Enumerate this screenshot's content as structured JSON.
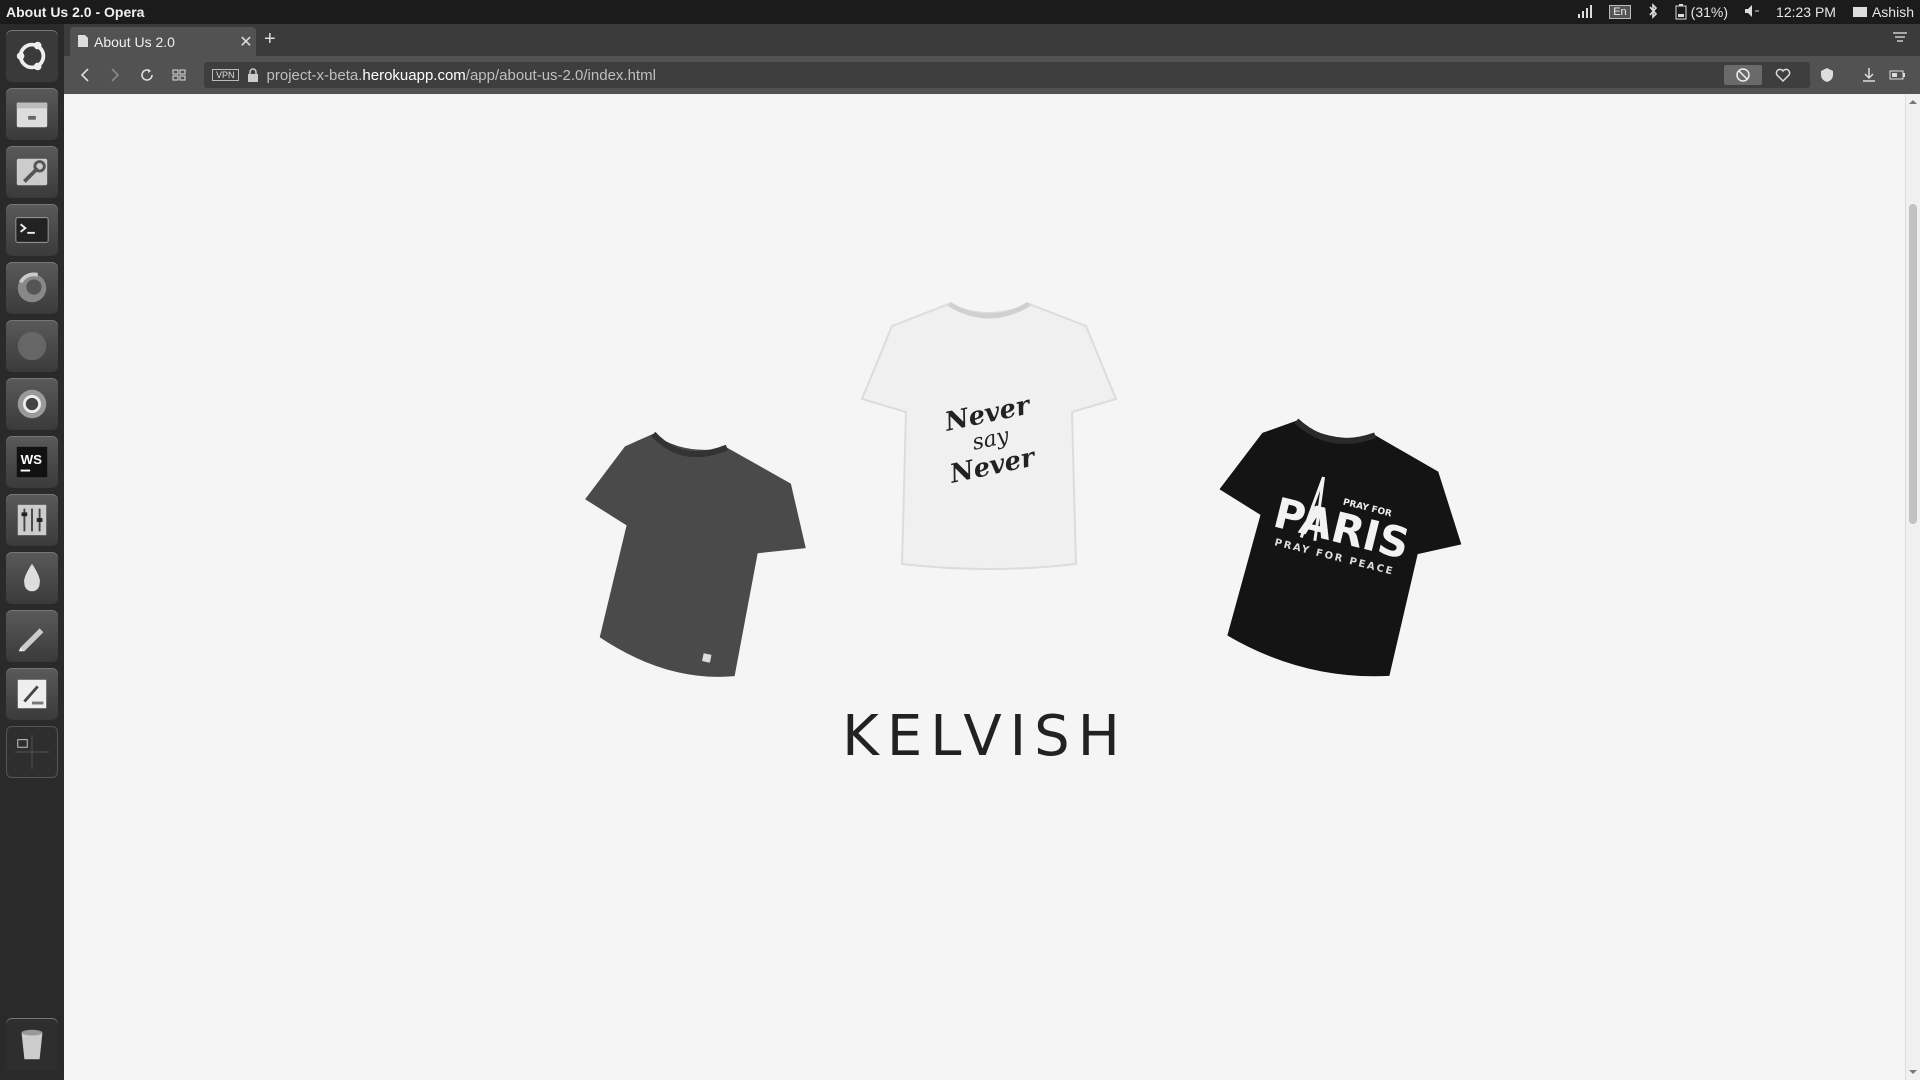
{
  "window_title": "About Us 2.0 - Opera",
  "panel": {
    "keyboard": "En",
    "battery": "(31%)",
    "time": "12:23 PM",
    "user": "Ashish"
  },
  "browser": {
    "tab_title": "About Us 2.0",
    "new_tab": "+",
    "vpn_label": "VPN",
    "url_prefix": "project-x-beta.",
    "url_host": "herokuapp.com",
    "url_path": "/app/about-us-2.0/index.html"
  },
  "page": {
    "brand": "KELVISH",
    "shirts": [
      {
        "name": "grey plain t-shirt",
        "color": "#4a4a4a"
      },
      {
        "name": "white Never say Never t-shirt",
        "color": "#f2f2f2",
        "print": [
          "Never",
          "say",
          "Never"
        ]
      },
      {
        "name": "black Pray for Paris t-shirt",
        "color": "#141414",
        "print": [
          "PRAY FOR",
          "PARIS",
          "PRAY FOR PEACE"
        ]
      }
    ]
  },
  "launcher": [
    "ubuntu-dash-icon",
    "files-icon",
    "system-settings-icon",
    "terminal-icon",
    "firefox-icon",
    "blank-app-icon",
    "chromium-icon",
    "webstorm-icon",
    "mixer-icon",
    "drop-icon",
    "pen-icon",
    "paint-icon",
    "workspace-icon",
    "trash-icon"
  ]
}
